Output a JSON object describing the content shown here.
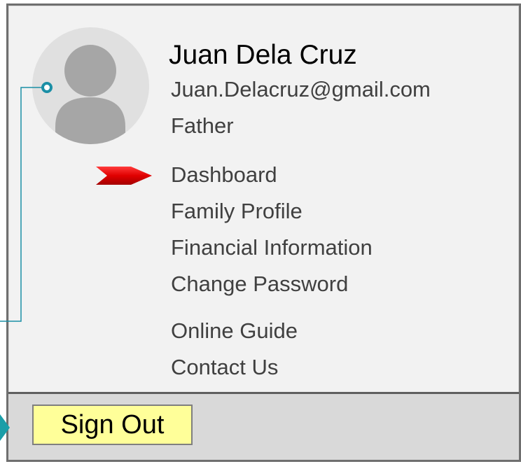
{
  "profile": {
    "name": "Juan Dela Cruz",
    "email": "Juan.Delacruz@gmail.com",
    "role": "Father",
    "avatar_icon": "user-silhouette-icon"
  },
  "menu": {
    "items": [
      {
        "label": "Dashboard",
        "active": true
      },
      {
        "label": "Family Profile"
      },
      {
        "label": "Financial Information"
      },
      {
        "label": "Change Password"
      },
      {
        "label": "Online Guide"
      },
      {
        "label": "Contact Us"
      }
    ],
    "active_indicator_icon": "red-arrow-icon"
  },
  "footer": {
    "signout_label": "Sign Out"
  },
  "colors": {
    "panel_bg": "#f2f2f2",
    "panel_border": "#6f6f6f",
    "footer_bg": "#d9d9d9",
    "signout_bg": "#ffff99",
    "accent_arrow": "#e00000",
    "connector": "#1b8fa6",
    "text_secondary": "#404040"
  }
}
